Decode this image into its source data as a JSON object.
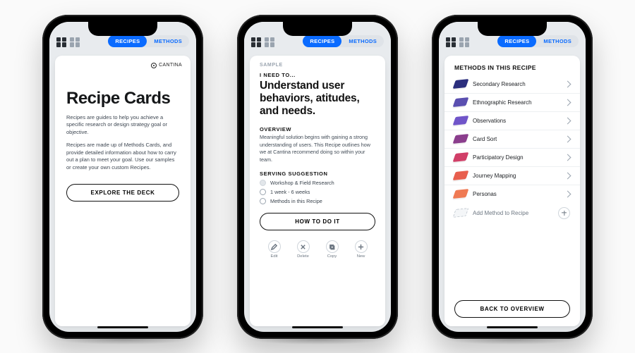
{
  "nav": {
    "tab_recipes": "RECIPES",
    "tab_methods": "METHODS"
  },
  "phone1": {
    "brand": "CANTINA",
    "title": "Recipe Cards",
    "p1": "Recipes are guides to help you achieve a specific research or design strategy goal or objective.",
    "p2": "Recipes are made up of Methods Cards, and provide detailed information about how to carry out a plan to meet your goal. Use our samples or create your own custom Recipes.",
    "cta": "EXPLORE THE DECK"
  },
  "phone2": {
    "eyebrow": "SAMPLE",
    "need_label": "I NEED TO...",
    "headline": "Understand user behaviors, atitudes, and needs.",
    "overview_label": "OVERVIEW",
    "overview_text": "Meaningful solution begins with gaining a strong understanding of users. This Recipe outlines how we at Cantina recommend doing so within your team.",
    "serving_label": "SERVING SUGGESTION",
    "serving": [
      "Workshop & Field Research",
      "1 week - 6 weeks",
      "Methods in this Recipe"
    ],
    "cta": "HOW TO DO IT",
    "tools": {
      "edit": "Edit",
      "delete": "Delete",
      "copy": "Copy",
      "new": "New"
    }
  },
  "phone3": {
    "header": "METHODS IN THIS RECIPE",
    "methods": [
      {
        "label": "Secondary Research",
        "color": "#2b2e7d"
      },
      {
        "label": "Ethnographic Research",
        "color": "#5a4fb0"
      },
      {
        "label": "Observations",
        "color": "#7055c9"
      },
      {
        "label": "Card Sort",
        "color": "#8b3e8d"
      },
      {
        "label": "Participatory Design",
        "color": "#d13f68"
      },
      {
        "label": "Journey Mapping",
        "color": "#e85f4e"
      },
      {
        "label": "Personas",
        "color": "#ef7a54"
      }
    ],
    "add_label": "Add Method to Recipe",
    "cta": "BACK TO OVERVIEW"
  }
}
